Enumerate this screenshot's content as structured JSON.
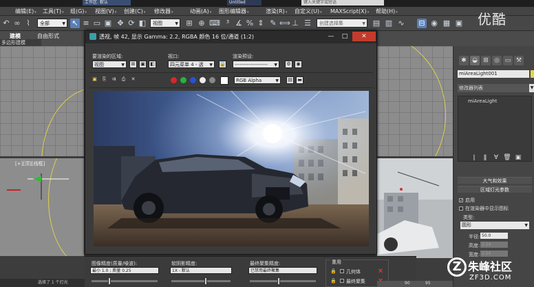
{
  "titlebar": {
    "tab1": "工作区: 默认",
    "tab2": "Untitled",
    "search_placeholder": "键入关键字或短语"
  },
  "menubar": {
    "items": [
      "编辑(E)",
      "工具(T)",
      "组(G)",
      "视图(V)",
      "创建(C)",
      "修改器",
      "动画(A)",
      "图形编辑器",
      "渲染(R)",
      "自定义(U)",
      "MAXScript(X)",
      "帮助(H)"
    ]
  },
  "toolbar": {
    "filter_value": "全部",
    "view_value": "视图",
    "selection_set_placeholder": "创建选择集"
  },
  "ribbon": {
    "tabs": [
      "建模",
      "自由形式"
    ],
    "sub_label": "多边形建模"
  },
  "viewport": {
    "label": "[+][顶][线框]"
  },
  "render_window": {
    "title": "透视, 帧 42, 显示 Gamma: 2.2, RGBA 颜色 16 位/通道 (1:2)",
    "area_label": "要渲染的区域:",
    "area_value": "视图",
    "viewport_label": "视口:",
    "viewport_value": "四元菜单 4 - 透",
    "preset_label": "渲染预设:",
    "preset_value": "-------------------",
    "channel_value": "RGB Alpha"
  },
  "bottom_panel": {
    "image_precision_label": "图像精度(质量/噪波):",
    "image_precision_value": "最小 1.0 ; 质量 0.25",
    "soft_shadow_label": "软阴影精度:",
    "soft_shadow_value": "1X - 默认",
    "final_gather_label": "最终聚集精度:",
    "final_gather_value": "已禁用最终聚集",
    "reuse_label": "重用",
    "geometry_label": "几何体",
    "final_gather_reuse_label": "最终聚集"
  },
  "command_panel": {
    "object_name": "miAreaLight001",
    "modifier_list": "修改器列表",
    "stack_item": "miAreaLight",
    "rollout_atmosphere": "大气和效果",
    "rollout_area_params": "区域灯光参数",
    "enabled_label": "启用",
    "enabled_checked": true,
    "show_icon_label": "在渲染器中显示图标",
    "type_label": "类型:",
    "type_value": "圆形",
    "radius_label": "半径:",
    "radius_value": "50.0",
    "height_label": "高度:",
    "height_value": "2.54",
    "width_label": "宽度:",
    "width_value": "2.54"
  },
  "statusbar": {
    "text": "选择了 1 个灯光"
  },
  "timeline": {
    "ticks": [
      "90",
      "95"
    ]
  },
  "watermark": {
    "top_right": "优酷",
    "brand": "朱峰社区",
    "url": "ZF3D.COM"
  },
  "colors": {
    "accent": "#5a7fb5",
    "close_button": "#c23b2c",
    "object_color": "#e8d34a"
  }
}
